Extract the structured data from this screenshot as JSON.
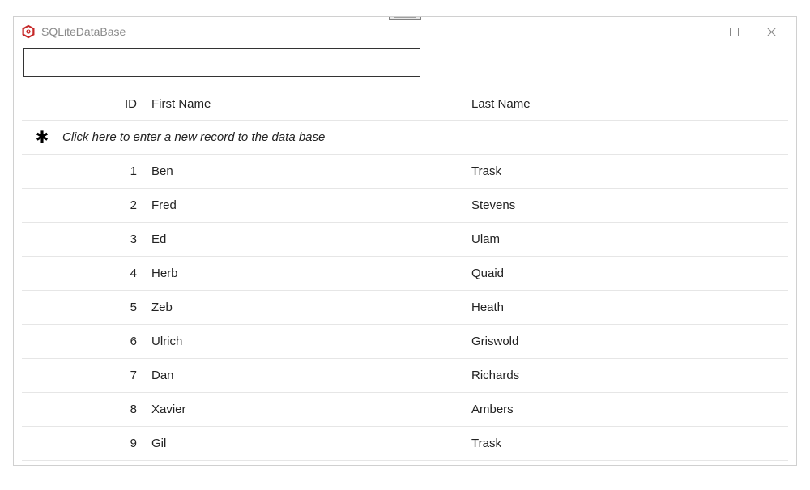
{
  "window": {
    "title": "SQLiteDataBase"
  },
  "search": {
    "value": "",
    "placeholder": ""
  },
  "columns": {
    "id": "ID",
    "first": "First Name",
    "last": "Last Name"
  },
  "new_record_prompt": "Click here to enter a new record to the data base",
  "rows": [
    {
      "id": "1",
      "first": "Ben",
      "last": "Trask"
    },
    {
      "id": "2",
      "first": "Fred",
      "last": "Stevens"
    },
    {
      "id": "3",
      "first": "Ed",
      "last": "Ulam"
    },
    {
      "id": "4",
      "first": "Herb",
      "last": "Quaid"
    },
    {
      "id": "5",
      "first": "Zeb",
      "last": "Heath"
    },
    {
      "id": "6",
      "first": "Ulrich",
      "last": "Griswold"
    },
    {
      "id": "7",
      "first": "Dan",
      "last": "Richards"
    },
    {
      "id": "8",
      "first": "Xavier",
      "last": "Ambers"
    },
    {
      "id": "9",
      "first": "Gil",
      "last": "Trask"
    }
  ]
}
